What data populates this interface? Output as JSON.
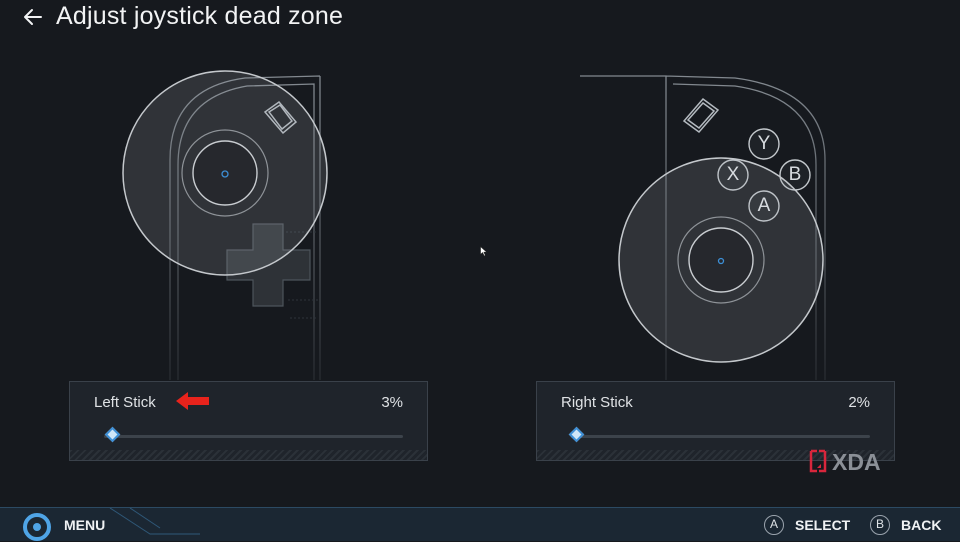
{
  "header": {
    "title": "Adjust joystick dead zone"
  },
  "controller": {
    "left_buttons": {
      "dpad": "dpad-icon"
    },
    "right_buttons": {
      "y": "Y",
      "x": "X",
      "b": "B",
      "a": "A"
    }
  },
  "left_stick": {
    "label": "Left Stick",
    "value_text": "3%",
    "value": 3
  },
  "right_stick": {
    "label": "Right Stick",
    "value_text": "2%",
    "value": 2
  },
  "watermark": {
    "text": "XDA"
  },
  "footer": {
    "menu_label": "MENU",
    "select_key": "A",
    "select_label": "SELECT",
    "back_key": "B",
    "back_label": "BACK"
  },
  "colors": {
    "background": "#16191e",
    "accent": "#3d8fd6",
    "annotation": "#e8231c",
    "footer": "#1b2733"
  }
}
